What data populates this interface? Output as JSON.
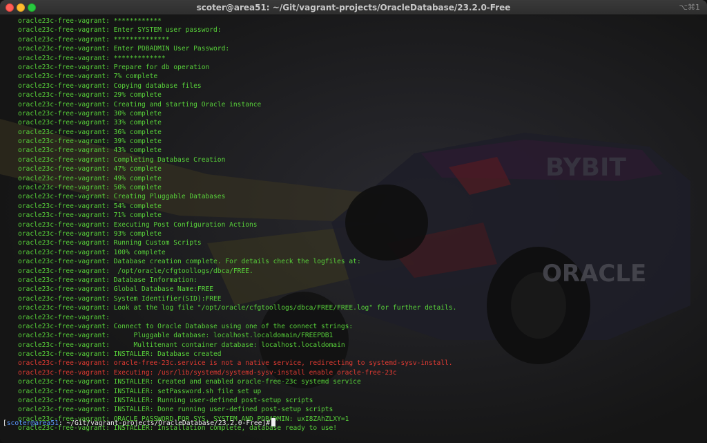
{
  "window": {
    "title": "scoter@area51: ~/Git/vagrant-projects/OracleDatabase/23.2.0-Free",
    "shortcut": "⌥⌘1"
  },
  "colors": {
    "output": "#58d23a",
    "error": "#e03a32",
    "prompt_user": "#5b9bff",
    "prompt_text": "#f0f0f0"
  },
  "background": {
    "description_icon": "race-car-wallpaper-icon",
    "car_text_1": "BYBIT",
    "car_text_2": "ORACLE"
  },
  "terminal": {
    "lines": [
      {
        "text": "oracle23c-free-vagrant: ************",
        "type": "normal"
      },
      {
        "text": "oracle23c-free-vagrant: Enter SYSTEM user password:",
        "type": "normal"
      },
      {
        "text": "oracle23c-free-vagrant: **************",
        "type": "normal"
      },
      {
        "text": "oracle23c-free-vagrant: Enter PDBADMIN User Password:",
        "type": "normal"
      },
      {
        "text": "oracle23c-free-vagrant: *************",
        "type": "normal"
      },
      {
        "text": "oracle23c-free-vagrant: Prepare for db operation",
        "type": "normal"
      },
      {
        "text": "oracle23c-free-vagrant: 7% complete",
        "type": "normal"
      },
      {
        "text": "oracle23c-free-vagrant: Copying database files",
        "type": "normal"
      },
      {
        "text": "oracle23c-free-vagrant: 29% complete",
        "type": "normal"
      },
      {
        "text": "oracle23c-free-vagrant: Creating and starting Oracle instance",
        "type": "normal"
      },
      {
        "text": "oracle23c-free-vagrant: 30% complete",
        "type": "normal"
      },
      {
        "text": "oracle23c-free-vagrant: 33% complete",
        "type": "normal"
      },
      {
        "text": "oracle23c-free-vagrant: 36% complete",
        "type": "normal"
      },
      {
        "text": "oracle23c-free-vagrant: 39% complete",
        "type": "normal"
      },
      {
        "text": "oracle23c-free-vagrant: 43% complete",
        "type": "normal"
      },
      {
        "text": "oracle23c-free-vagrant: Completing Database Creation",
        "type": "normal"
      },
      {
        "text": "oracle23c-free-vagrant: 47% complete",
        "type": "normal"
      },
      {
        "text": "oracle23c-free-vagrant: 49% complete",
        "type": "normal"
      },
      {
        "text": "oracle23c-free-vagrant: 50% complete",
        "type": "normal"
      },
      {
        "text": "oracle23c-free-vagrant: Creating Pluggable Databases",
        "type": "normal"
      },
      {
        "text": "oracle23c-free-vagrant: 54% complete",
        "type": "normal"
      },
      {
        "text": "oracle23c-free-vagrant: 71% complete",
        "type": "normal"
      },
      {
        "text": "oracle23c-free-vagrant: Executing Post Configuration Actions",
        "type": "normal"
      },
      {
        "text": "oracle23c-free-vagrant: 93% complete",
        "type": "normal"
      },
      {
        "text": "oracle23c-free-vagrant: Running Custom Scripts",
        "type": "normal"
      },
      {
        "text": "oracle23c-free-vagrant: 100% complete",
        "type": "normal"
      },
      {
        "text": "oracle23c-free-vagrant: Database creation complete. For details check the logfiles at:",
        "type": "normal"
      },
      {
        "text": "oracle23c-free-vagrant:  /opt/oracle/cfgtoollogs/dbca/FREE.",
        "type": "normal"
      },
      {
        "text": "oracle23c-free-vagrant: Database Information:",
        "type": "normal"
      },
      {
        "text": "oracle23c-free-vagrant: Global Database Name:FREE",
        "type": "normal"
      },
      {
        "text": "oracle23c-free-vagrant: System Identifier(SID):FREE",
        "type": "normal"
      },
      {
        "text": "oracle23c-free-vagrant: Look at the log file \"/opt/oracle/cfgtoollogs/dbca/FREE/FREE.log\" for further details.",
        "type": "normal"
      },
      {
        "text": "oracle23c-free-vagrant:",
        "type": "normal"
      },
      {
        "text": "oracle23c-free-vagrant: Connect to Oracle Database using one of the connect strings:",
        "type": "normal"
      },
      {
        "text": "oracle23c-free-vagrant:      Pluggable database: localhost.localdomain/FREEPDB1",
        "type": "normal"
      },
      {
        "text": "oracle23c-free-vagrant:      Multitenant container database: localhost.localdomain",
        "type": "normal"
      },
      {
        "text": "oracle23c-free-vagrant: INSTALLER: Database created",
        "type": "normal"
      },
      {
        "text": "oracle23c-free-vagrant: oracle-free-23c.service is not a native service, redirecting to systemd-sysv-install.",
        "type": "error"
      },
      {
        "text": "oracle23c-free-vagrant: Executing: /usr/lib/systemd/systemd-sysv-install enable oracle-free-23c",
        "type": "error"
      },
      {
        "text": "oracle23c-free-vagrant: INSTALLER: Created and enabled oracle-free-23c systemd service",
        "type": "normal"
      },
      {
        "text": "oracle23c-free-vagrant: INSTALLER: setPassword.sh file set up",
        "type": "normal"
      },
      {
        "text": "oracle23c-free-vagrant: INSTALLER: Running user-defined post-setup scripts",
        "type": "normal"
      },
      {
        "text": "oracle23c-free-vagrant: INSTALLER: Done running user-defined post-setup scripts",
        "type": "normal"
      },
      {
        "text": "oracle23c-free-vagrant: ORACLE PASSWORD FOR SYS, SYSTEM AND PDBADMIN: uxI8ZAhZLXY=1",
        "type": "normal"
      },
      {
        "text": "oracle23c-free-vagrant: INSTALLER: Installation complete, database ready to use!",
        "type": "normal"
      }
    ]
  },
  "prompt": {
    "open_bracket": "[",
    "user_host": "scoter@area51",
    "path": ": ~/Git/vagrant-projects/OracleDatabase/23.2.0-Free]#"
  }
}
